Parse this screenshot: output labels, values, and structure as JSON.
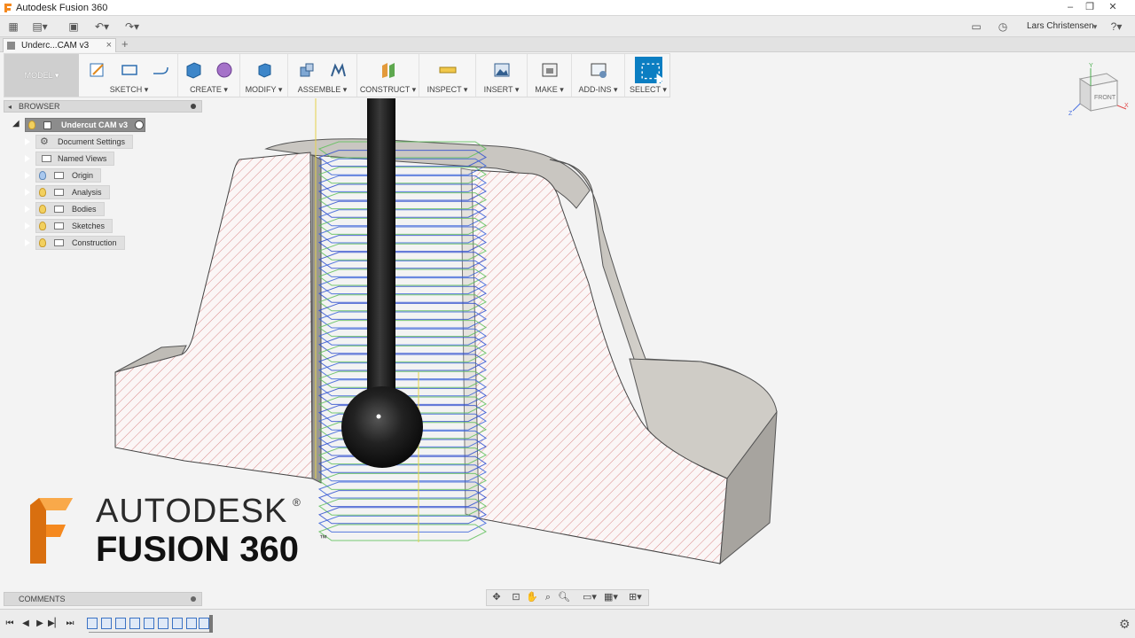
{
  "window": {
    "title": "Autodesk Fusion 360"
  },
  "user": {
    "name": "Lars Christensen"
  },
  "document_tab": {
    "label": "Underc...CAM v3"
  },
  "toolbar": {
    "workspace": "MODEL",
    "groups": [
      {
        "label": "SKETCH"
      },
      {
        "label": "CREATE"
      },
      {
        "label": "MODIFY"
      },
      {
        "label": "ASSEMBLE"
      },
      {
        "label": "CONSTRUCT"
      },
      {
        "label": "INSPECT"
      },
      {
        "label": "INSERT"
      },
      {
        "label": "MAKE"
      },
      {
        "label": "ADD-INS"
      },
      {
        "label": "SELECT"
      }
    ]
  },
  "browser": {
    "title": "BROWSER",
    "root": "Undercut CAM v3",
    "items": [
      {
        "label": "Document Settings",
        "icon": "gear-icon"
      },
      {
        "label": "Named Views",
        "icon": "folder-icon"
      },
      {
        "label": "Origin",
        "icon": "folder-icon"
      },
      {
        "label": "Analysis",
        "icon": "folder-icon"
      },
      {
        "label": "Bodies",
        "icon": "folder-icon"
      },
      {
        "label": "Sketches",
        "icon": "folder-icon"
      },
      {
        "label": "Construction",
        "icon": "folder-icon"
      }
    ]
  },
  "viewcube": {
    "face": "FRONT",
    "axis_x": "X",
    "axis_y": "Y",
    "axis_z": "Z"
  },
  "logo": {
    "line1": "AUTODESK",
    "line2": "FUSION 360",
    "reg": "®",
    "tm": "™"
  },
  "comments": {
    "title": "COMMENTS"
  },
  "colors": {
    "accent": "#0b7ec2",
    "logo_orange": "#f5891f",
    "section_hatch": "#d98a8a"
  }
}
